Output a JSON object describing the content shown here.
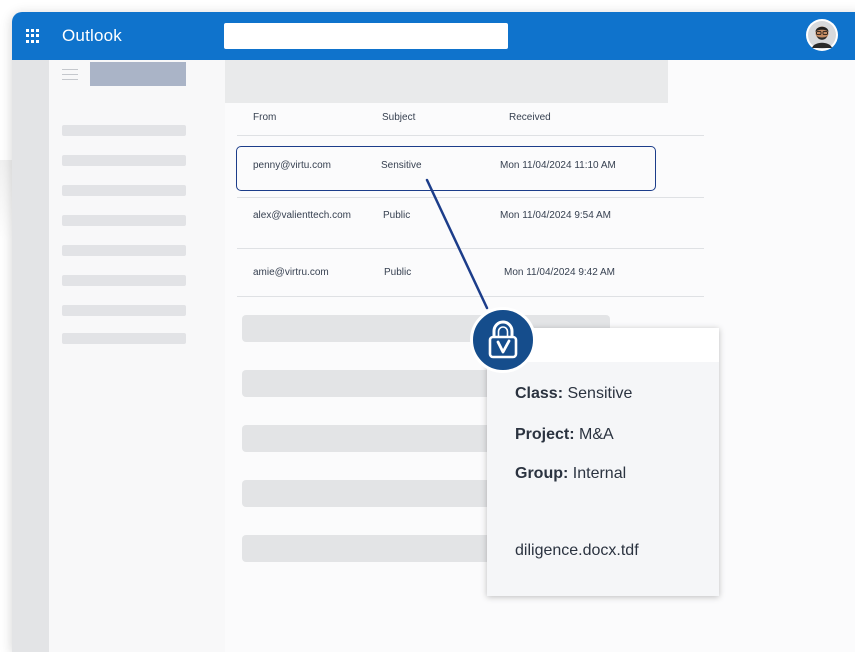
{
  "app": {
    "title": "Outlook"
  },
  "search": {
    "value": "",
    "placeholder": ""
  },
  "icons": {
    "waffle": "app-launcher-icon",
    "menu": "hamburger-icon",
    "avatar": "user-avatar-icon",
    "lock": "lock-v-icon"
  },
  "colors": {
    "topbar": "#0f73cc",
    "accent": "#154d8c",
    "outline": "#1c3d8a"
  },
  "mail_list": {
    "columns": [
      "From",
      "Subject",
      "Received"
    ],
    "rows": [
      {
        "from": "penny@virtu.com",
        "subject": "Sensitive",
        "received": "Mon 11/04/2024 11:10 AM",
        "selected": true
      },
      {
        "from": "alex@valienttech.com",
        "subject": "Public",
        "received": "Mon 11/04/2024 9:54 AM",
        "selected": false
      },
      {
        "from": "amie@virtru.com",
        "subject": "Public",
        "received": "Mon 11/04/2024 9:42 AM",
        "selected": false
      }
    ]
  },
  "metadata_panel": {
    "class_label": "Class:",
    "class_value": "Sensitive",
    "project_label": "Project:",
    "project_value": "M&A",
    "group_label": "Group:",
    "group_value": "Internal",
    "filename": "diligence.docx.tdf"
  }
}
